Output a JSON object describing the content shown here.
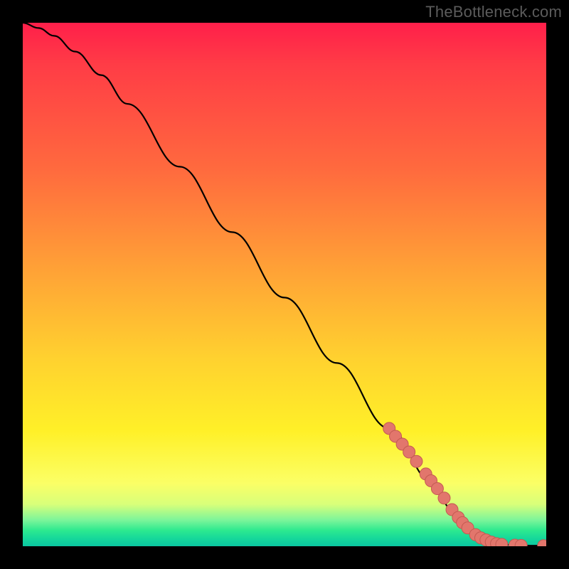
{
  "attribution": "TheBottleneck.com",
  "colors": {
    "frame": "#000000",
    "curve": "#000000",
    "marker_fill": "#e2766c",
    "marker_stroke": "#c45a52",
    "gradient_top": "#ff1f4a",
    "gradient_bottom": "#0bc6a0"
  },
  "chart_data": {
    "type": "line",
    "title": "",
    "xlabel": "",
    "ylabel": "",
    "xlim": [
      0,
      100
    ],
    "ylim": [
      0,
      100
    ],
    "series": [
      {
        "name": "curve",
        "x": [
          0,
          3,
          6,
          10,
          15,
          20,
          30,
          40,
          50,
          60,
          70,
          78,
          82,
          85,
          88,
          90,
          92,
          95,
          98,
          100
        ],
        "y": [
          100,
          99,
          97.5,
          94.5,
          90,
          84.5,
          72.5,
          60,
          47.5,
          35,
          22.5,
          12.5,
          7,
          3.5,
          1.3,
          0.6,
          0.3,
          0.15,
          0.1,
          0.1
        ]
      }
    ],
    "markers": [
      {
        "x": 70.0,
        "y": 22.5
      },
      {
        "x": 71.2,
        "y": 21.0
      },
      {
        "x": 72.5,
        "y": 19.5
      },
      {
        "x": 73.8,
        "y": 18.0
      },
      {
        "x": 75.2,
        "y": 16.2
      },
      {
        "x": 77.0,
        "y": 13.8
      },
      {
        "x": 78.0,
        "y": 12.5
      },
      {
        "x": 79.2,
        "y": 11.0
      },
      {
        "x": 80.5,
        "y": 9.2
      },
      {
        "x": 82.0,
        "y": 7.0
      },
      {
        "x": 83.2,
        "y": 5.5
      },
      {
        "x": 84.0,
        "y": 4.5
      },
      {
        "x": 85.0,
        "y": 3.5
      },
      {
        "x": 86.5,
        "y": 2.2
      },
      {
        "x": 87.5,
        "y": 1.6
      },
      {
        "x": 88.5,
        "y": 1.2
      },
      {
        "x": 89.5,
        "y": 0.8
      },
      {
        "x": 90.5,
        "y": 0.5
      },
      {
        "x": 91.5,
        "y": 0.35
      },
      {
        "x": 94.0,
        "y": 0.2
      },
      {
        "x": 95.2,
        "y": 0.15
      },
      {
        "x": 99.5,
        "y": 0.1
      }
    ]
  }
}
